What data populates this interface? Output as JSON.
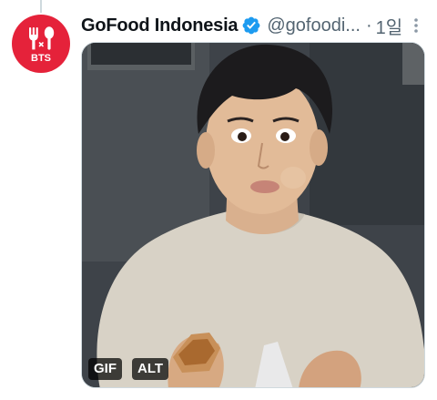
{
  "tweet": {
    "display_name": "GoFood Indonesia",
    "handle": "@gofoodi...",
    "separator": "·",
    "time": "1일",
    "avatar_logo_text": "BTS",
    "icons": {
      "verified": "verified-badge-icon",
      "more": "more-options-icon"
    }
  },
  "media": {
    "gif_badge": "GIF",
    "alt_badge": "ALT"
  },
  "colors": {
    "avatar_bg": "#e5223a",
    "verified": "#1d9bf0",
    "secondary_text": "#536471"
  }
}
